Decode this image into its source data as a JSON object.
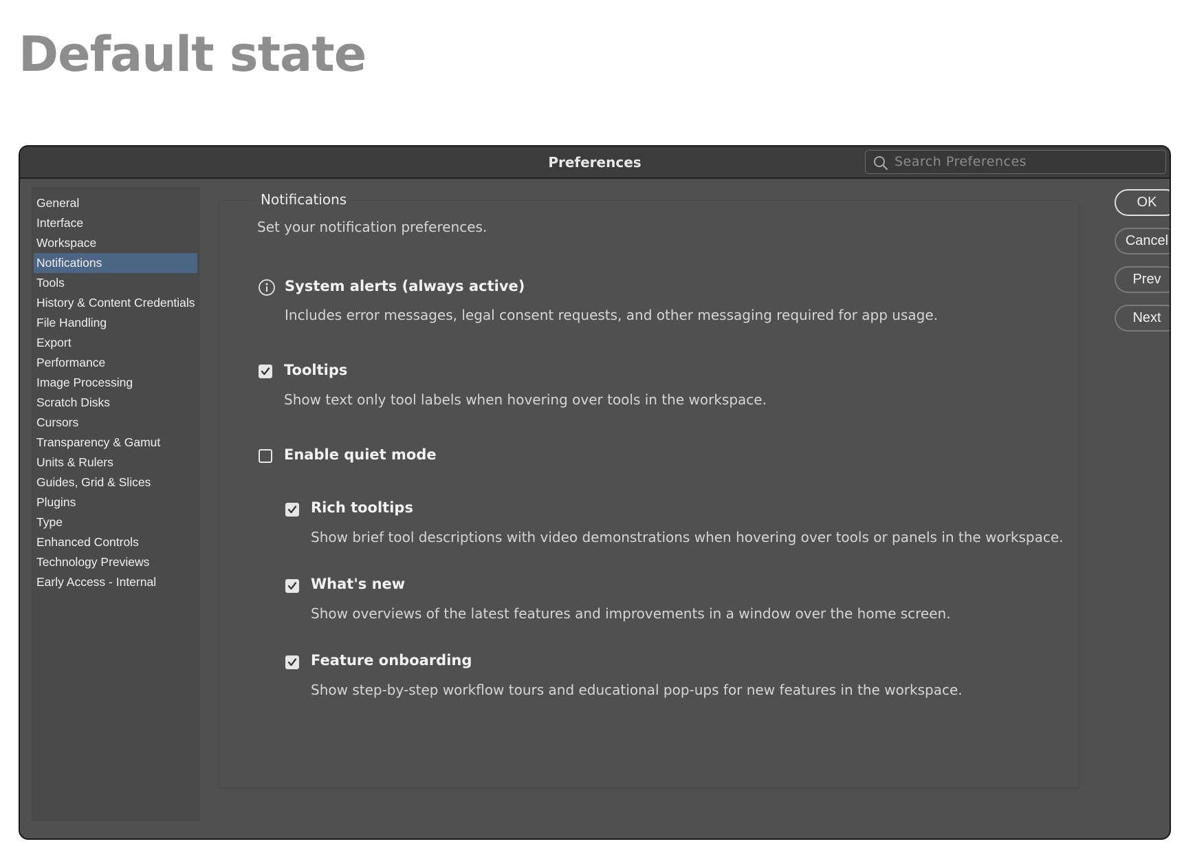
{
  "page_heading": "Default state",
  "dialog": {
    "title": "Preferences",
    "search_placeholder": "Search Preferences"
  },
  "sidebar": {
    "selected": "Notifications",
    "items": [
      "General",
      "Interface",
      "Workspace",
      "Notifications",
      "Tools",
      "History & Content Credentials",
      "File Handling",
      "Export",
      "Performance",
      "Image Processing",
      "Scratch Disks",
      "Cursors",
      "Transparency & Gamut",
      "Units & Rulers",
      "Guides, Grid & Slices",
      "Plugins",
      "Type",
      "Enhanced Controls",
      "Technology Previews",
      "Early Access - Internal"
    ]
  },
  "notifications": {
    "section_title": "Notifications",
    "subtitle": "Set your notification preferences.",
    "system_alerts": {
      "label": "System alerts (always active)",
      "description": "Includes error messages, legal consent requests, and other messaging required for app usage."
    },
    "tooltips": {
      "label": "Tooltips",
      "checked": true,
      "description": "Show text only tool labels when hovering over tools in the workspace."
    },
    "quiet_mode": {
      "label": "Enable quiet mode",
      "checked": false
    },
    "rich_tooltips": {
      "label": "Rich tooltips",
      "checked": true,
      "description": "Show brief tool descriptions with video demonstrations when hovering over tools or panels in the workspace."
    },
    "whats_new": {
      "label": "What's new",
      "checked": true,
      "description": "Show overviews of the latest features and improvements in a window over the home screen."
    },
    "feature_onboarding": {
      "label": "Feature onboarding",
      "checked": true,
      "description": "Show step-by-step workflow tours and educational pop-ups for new features in the workspace."
    }
  },
  "buttons": {
    "ok": "OK",
    "cancel": "Cancel",
    "prev": "Prev",
    "next": "Next"
  },
  "colors": {
    "dialog_bg": "#505050",
    "titlebar_bg": "#3c3c3c",
    "selection": "#4b6585",
    "heading_gray": "#8e8e8e"
  }
}
